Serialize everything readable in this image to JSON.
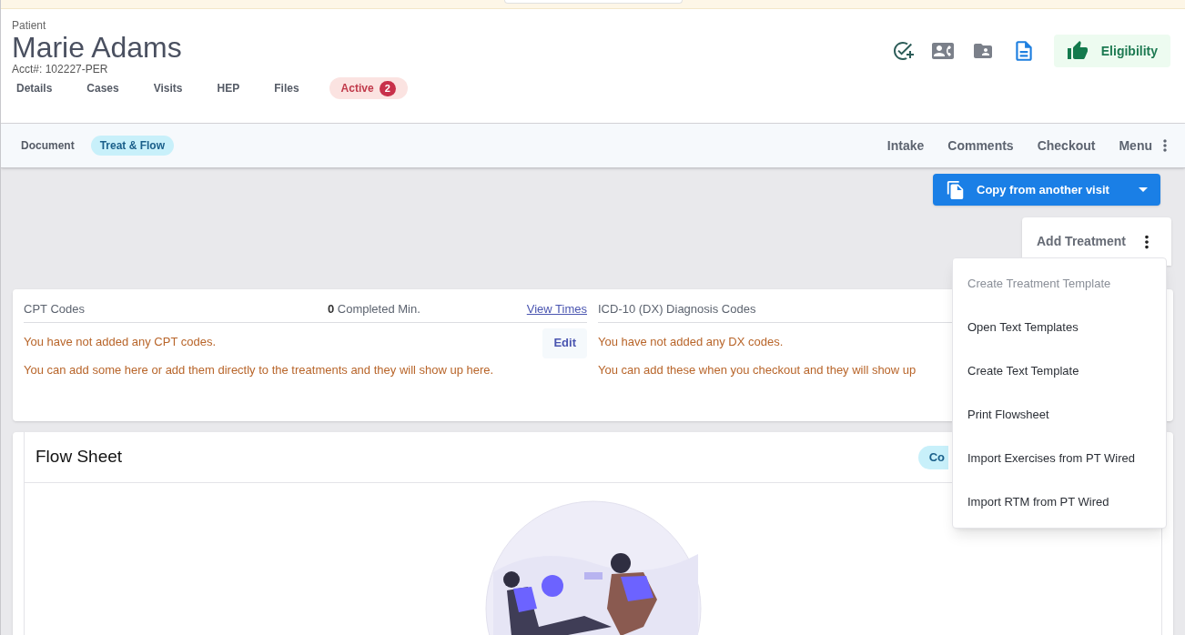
{
  "patient": {
    "label": "Patient",
    "name": "Marie Adams",
    "account": "Acct#: 102227-PER"
  },
  "header_actions": {
    "eligibility": "Eligibility"
  },
  "patient_tabs": [
    {
      "label": "Details",
      "selected": false
    },
    {
      "label": "Cases",
      "selected": false
    },
    {
      "label": "Visits",
      "selected": false
    },
    {
      "label": "HEP",
      "selected": false
    },
    {
      "label": "Files",
      "selected": false
    },
    {
      "label": "Active",
      "selected": true,
      "count": "2"
    }
  ],
  "visit_tabs": [
    {
      "label": "Document",
      "selected": false
    },
    {
      "label": "Treat & Flow",
      "selected": true
    }
  ],
  "visit_actions": [
    "Intake",
    "Comments",
    "Checkout",
    "Menu"
  ],
  "copy_button": "Copy from another visit",
  "add_treatment": "Add Treatment",
  "cpt": {
    "title": "CPT Codes",
    "completed_count": "0",
    "completed_label": "Completed Min.",
    "link": "View Times",
    "empty": "You have not added any CPT codes.",
    "hint": "You can add some here or add them directly to the treatments and they will show up here.",
    "edit": "Edit"
  },
  "dx": {
    "title": "ICD-10 (DX) Diagnosis Codes",
    "empty": "You have not added any DX codes.",
    "hint": "You can add these when you checkout and they will show up"
  },
  "flow_sheet": {
    "title": "Flow Sheet",
    "badge": "Co"
  },
  "menu": [
    {
      "label": "Create Treatment Template",
      "disabled": true
    },
    {
      "label": "Open Text Templates",
      "disabled": false
    },
    {
      "label": "Create Text Template",
      "disabled": false
    },
    {
      "label": "Print Flowsheet",
      "disabled": false
    },
    {
      "label": "Import Exercises from PT Wired",
      "disabled": false
    },
    {
      "label": "Import RTM from PT Wired",
      "disabled": false
    }
  ]
}
